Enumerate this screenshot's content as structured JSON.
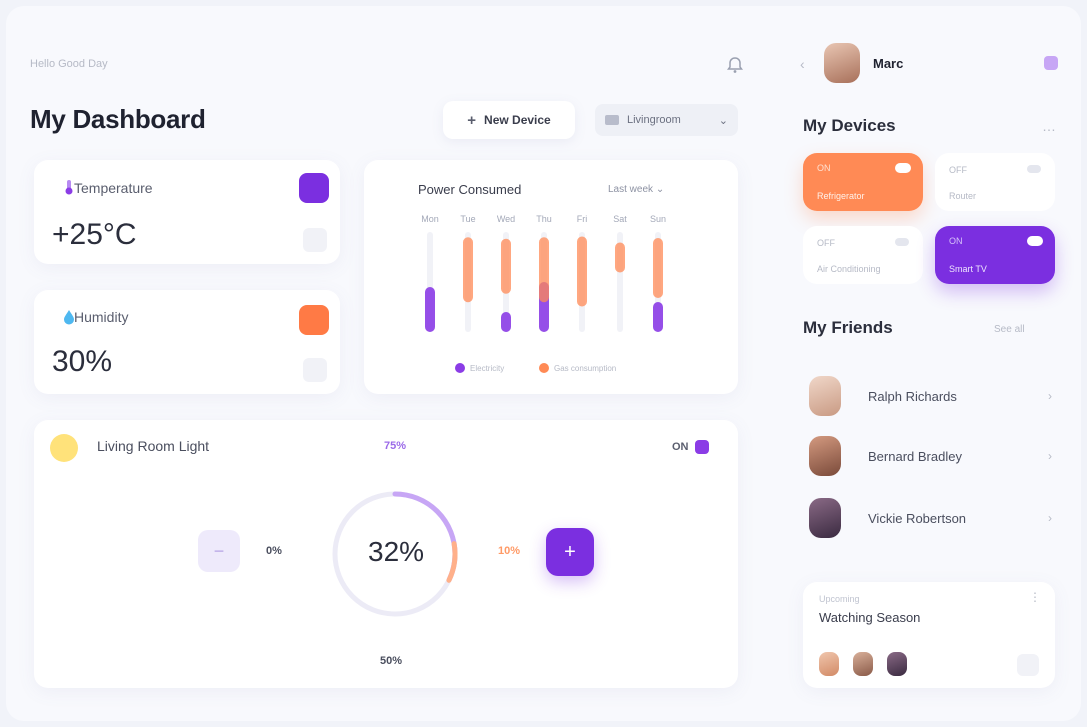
{
  "header": {
    "breadcrumb": "Hello Good Day",
    "title": "My Dashboard",
    "new_button_label": "New Device",
    "select_value": "Livingroom"
  },
  "sensors": [
    {
      "title": "Temperature",
      "value": "+25°C",
      "color": "#7b2fe0"
    },
    {
      "title": "Humidity",
      "value": "30%",
      "color": "#ff7a45"
    }
  ],
  "chart_data": {
    "type": "bar",
    "title": "Power Consumed",
    "filter": "Last week",
    "categories": [
      "Mon",
      "Tue",
      "Wed",
      "Thu",
      "Fri",
      "Sat",
      "Sun"
    ],
    "series": [
      {
        "name": "Electricity",
        "color": "#8b3ce6",
        "values": [
          45,
          0,
          20,
          50,
          0,
          0,
          30
        ]
      },
      {
        "name": "Gas consumption",
        "color": "#ff8a55",
        "values": [
          0,
          65,
          55,
          65,
          70,
          30,
          60
        ]
      }
    ],
    "ylim": [
      0,
      100
    ],
    "legend_position": "bottom"
  },
  "light": {
    "title": "Living Room Light",
    "top_value": "75%",
    "toggle_label": "ON",
    "left_value": "0%",
    "right_value": "10%",
    "ring_value": "32%",
    "bottom_value": "50%",
    "ring_fraction": 0.32
  },
  "user": {
    "name": "Marc"
  },
  "devices": {
    "title": "My Devices",
    "items": [
      {
        "name": "Refrigerator",
        "status": "ON",
        "active": true,
        "color": "#ff8a55"
      },
      {
        "name": "Router",
        "status": "OFF",
        "active": false,
        "color": "#ffffff"
      },
      {
        "name": "Air Conditioning",
        "status": "OFF",
        "active": false,
        "color": "#ffffff"
      },
      {
        "name": "Smart TV",
        "status": "ON",
        "active": true,
        "color": "#7b2fe0"
      }
    ]
  },
  "friends": {
    "title": "My Friends",
    "link": "See all",
    "items": [
      {
        "name": "Ralph Richards"
      },
      {
        "name": "Bernard Bradley"
      },
      {
        "name": "Vickie Robertson"
      }
    ]
  },
  "event": {
    "label": "Upcoming",
    "title": "Watching Season"
  }
}
